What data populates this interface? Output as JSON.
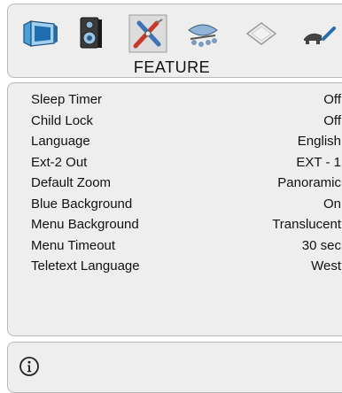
{
  "header": {
    "tabs": [
      {
        "id": "picture",
        "icon": "picture-tv-icon"
      },
      {
        "id": "sound",
        "icon": "speaker-icon"
      },
      {
        "id": "feature",
        "icon": "tools-icon",
        "selected": true
      },
      {
        "id": "install",
        "icon": "satellite-dish-icon"
      },
      {
        "id": "source",
        "icon": "source-card-icon"
      },
      {
        "id": "more",
        "icon": "more-icon"
      }
    ],
    "title": "FEATURE"
  },
  "menu": {
    "items": [
      {
        "label": "Sleep Timer",
        "value": "Off"
      },
      {
        "label": "Child Lock",
        "value": "Off"
      },
      {
        "label": "Language",
        "value": "English"
      },
      {
        "label": "Ext-2 Out",
        "value": "EXT - 1"
      },
      {
        "label": "Default Zoom",
        "value": "Panoramic"
      },
      {
        "label": "Blue Background",
        "value": "On"
      },
      {
        "label": "Menu Background",
        "value": "Translucent"
      },
      {
        "label": "Menu Timeout",
        "value": "30 sec"
      },
      {
        "label": "Teletext Language",
        "value": "West"
      }
    ]
  },
  "footer": {
    "info_icon": "info-icon"
  }
}
